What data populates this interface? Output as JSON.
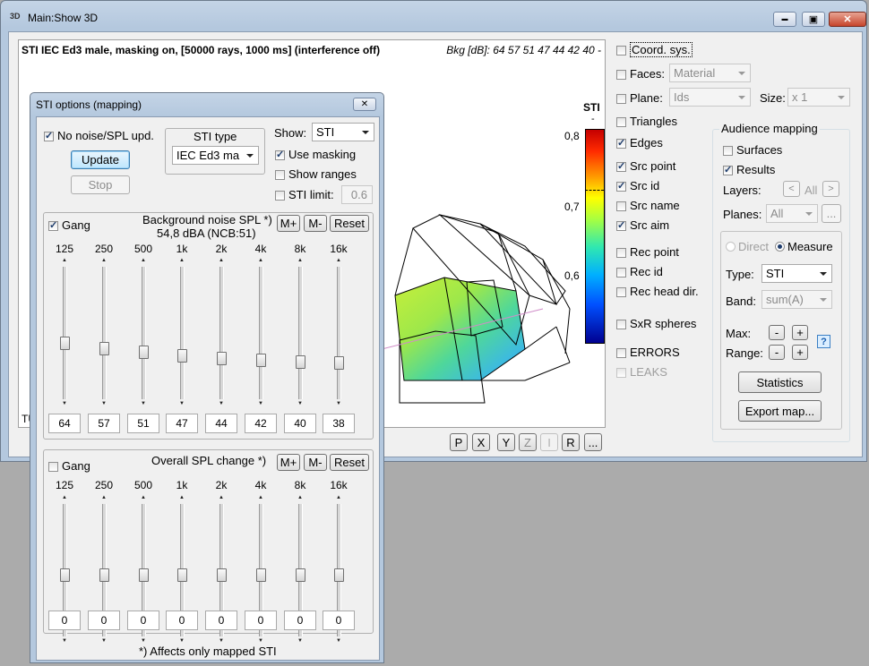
{
  "main_window": {
    "title": "Main:Show 3D",
    "app_icon_text": "3D",
    "minimize_glyph": "▬",
    "maximize_glyph": "▣",
    "close_glyph": "✕"
  },
  "view": {
    "header": "STI IEC Ed3 male, masking on,  [50000 rays, 1000 ms] (interference off)",
    "bkg": "Bkg [dB]: 64 57 51 47 44 42 40 -",
    "corner_text": "TU",
    "colorbar": {
      "title": "STI",
      "unit": "-",
      "ticks": [
        "0,8",
        "0,7",
        "0,6"
      ]
    },
    "buttons": [
      "P",
      "X",
      "Y",
      "Z",
      "I",
      "R",
      "..."
    ]
  },
  "right_panel": {
    "coord_sys": "Coord. sys.",
    "faces": "Faces:",
    "faces_value": "Material",
    "plane": "Plane:",
    "plane_value": "Ids",
    "size": "Size:",
    "size_value": "x 1",
    "triangles": "Triangles",
    "edges": "Edges",
    "src_point": "Src point",
    "src_id": "Src id",
    "src_name": "Src name",
    "src_aim": "Src aim",
    "rec_point": "Rec point",
    "rec_id": "Rec id",
    "rec_head_dir": "Rec head dir.",
    "sxr_spheres": "SxR spheres",
    "errors": "ERRORS",
    "leaks": "LEAKS"
  },
  "audience": {
    "title": "Audience mapping",
    "surfaces": "Surfaces",
    "results": "Results",
    "layers": "Layers:",
    "layers_all": "All",
    "layers_prev": "<",
    "layers_next": ">",
    "planes": "Planes:",
    "planes_value": "All",
    "planes_more": "...",
    "direct": "Direct",
    "measure": "Measure",
    "type": "Type:",
    "type_value": "STI",
    "band": "Band:",
    "band_value": "sum(A)",
    "max": "Max:",
    "range": "Range:",
    "minus": "-",
    "plus": "+",
    "help": "?",
    "statistics": "Statistics",
    "export": "Export map..."
  },
  "options": {
    "title": "STI options (mapping)",
    "close_glyph": "✕",
    "no_noise": "No noise/SPL upd.",
    "update": "Update",
    "stop": "Stop",
    "sti_type_label": "STI type",
    "sti_type_value": "IEC Ed3 ma",
    "show_label": "Show:",
    "show_value": "STI",
    "use_masking": "Use masking",
    "show_ranges": "Show ranges",
    "sti_limit": "STI limit:",
    "sti_limit_value": "0.6",
    "footnote": "*) Affects only mapped STI"
  },
  "bg_noise": {
    "gang": "Gang",
    "gang_checked": true,
    "title": "Background noise SPL *)",
    "subtitle": "54,8 dBA (NCB:51)",
    "mplus": "M+",
    "mminus": "M-",
    "reset": "Reset",
    "bands": [
      "125",
      "250",
      "500",
      "1k",
      "2k",
      "4k",
      "8k",
      "16k"
    ],
    "values": [
      "64",
      "57",
      "51",
      "47",
      "44",
      "42",
      "40",
      "38"
    ]
  },
  "spl_change": {
    "gang": "Gang",
    "gang_checked": false,
    "title": "Overall SPL change *)",
    "mplus": "M+",
    "mminus": "M-",
    "reset": "Reset",
    "bands": [
      "125",
      "250",
      "500",
      "1k",
      "2k",
      "4k",
      "8k",
      "16k"
    ],
    "values": [
      "0",
      "0",
      "0",
      "0",
      "0",
      "0",
      "0",
      "0"
    ]
  }
}
